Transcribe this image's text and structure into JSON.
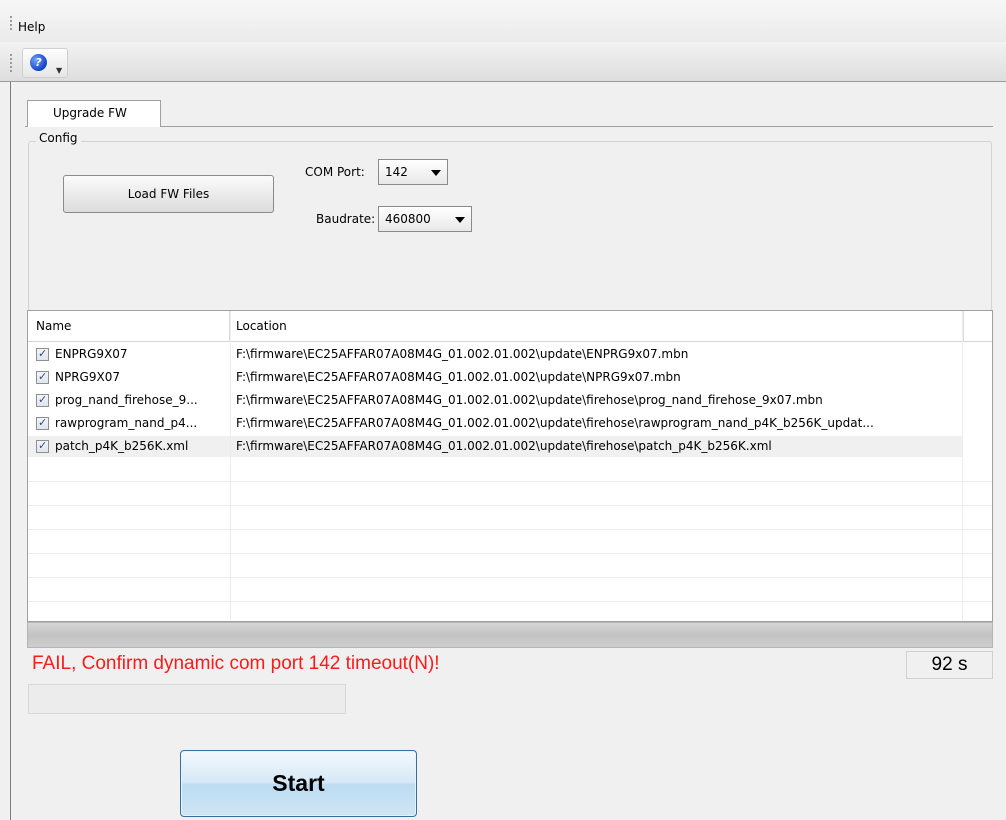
{
  "menu": {
    "help_label": "Help"
  },
  "toolbar": {
    "help_icon": "help-circle-icon",
    "help_glyph": "?",
    "dropdown_glyph": "▼"
  },
  "tab": {
    "label": "Upgrade FW"
  },
  "config": {
    "group_title": "Config",
    "load_button": "Load FW Files",
    "com_port_label": "COM Port:",
    "com_port_value": "142",
    "baudrate_label": "Baudrate:",
    "baudrate_value": "460800"
  },
  "table": {
    "columns": [
      "Name",
      "Location"
    ],
    "rows": [
      {
        "name": "ENPRG9X07",
        "checked": true,
        "location": "F:\\firmware\\EC25AFFAR07A08M4G_01.002.01.002\\update\\ENPRG9x07.mbn"
      },
      {
        "name": "NPRG9X07",
        "checked": true,
        "location": "F:\\firmware\\EC25AFFAR07A08M4G_01.002.01.002\\update\\NPRG9x07.mbn"
      },
      {
        "name": "prog_nand_firehose_9...",
        "checked": true,
        "location": "F:\\firmware\\EC25AFFAR07A08M4G_01.002.01.002\\update\\firehose\\prog_nand_firehose_9x07.mbn"
      },
      {
        "name": "rawprogram_nand_p4...",
        "checked": true,
        "location": "F:\\firmware\\EC25AFFAR07A08M4G_01.002.01.002\\update\\firehose\\rawprogram_nand_p4K_b256K_updat..."
      },
      {
        "name": "patch_p4K_b256K.xml",
        "checked": true,
        "location": "F:\\firmware\\EC25AFFAR07A08M4G_01.002.01.002\\update\\firehose\\patch_p4K_b256K.xml"
      }
    ]
  },
  "progress": {
    "value": 0
  },
  "status": {
    "message": "FAIL, Confirm dynamic com port 142 timeout(N)!",
    "elapsed": "92 s",
    "message_color": "#ff1a1a"
  },
  "start_button": {
    "label": "Start"
  }
}
